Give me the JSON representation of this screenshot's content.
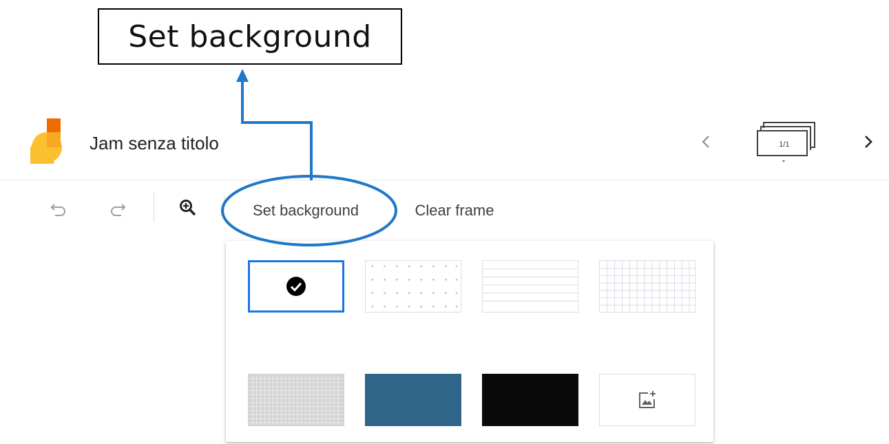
{
  "annotation": {
    "callout_text": "Set background",
    "arrow_color": "#1f78c8",
    "highlight_color": "#1f78c8"
  },
  "header": {
    "app_icon": "jamboard-logo-icon",
    "doc_title": "Jam senza titolo",
    "nav_prev_icon": "chevron-left-icon",
    "frame_counter": "1/1",
    "frame_counter_icon": "frames-stack-icon",
    "nav_next_icon": "chevron-right-icon"
  },
  "toolbar": {
    "undo_icon": "undo-icon",
    "redo_icon": "redo-icon",
    "zoom_icon": "zoom-in-icon",
    "set_background_label": "Set background",
    "clear_frame_label": "Clear frame"
  },
  "background_picker": {
    "selected_index": 0,
    "options": [
      {
        "id": "blank",
        "icon": "check-circle-icon",
        "selected": true
      },
      {
        "id": "dots"
      },
      {
        "id": "lines"
      },
      {
        "id": "grid"
      },
      {
        "id": "dark-grid",
        "color": "#d4d4d4"
      },
      {
        "id": "blue",
        "color": "#2e6589"
      },
      {
        "id": "black",
        "color": "#0a0a0a"
      },
      {
        "id": "upload-image",
        "icon": "add-image-icon"
      }
    ],
    "selection_color": "#1a73e8"
  },
  "colors": {
    "logo_orange": "#f28b1d",
    "logo_yellow": "#fbc02d",
    "text_primary": "#202124",
    "icon_gray": "#5f6368"
  }
}
